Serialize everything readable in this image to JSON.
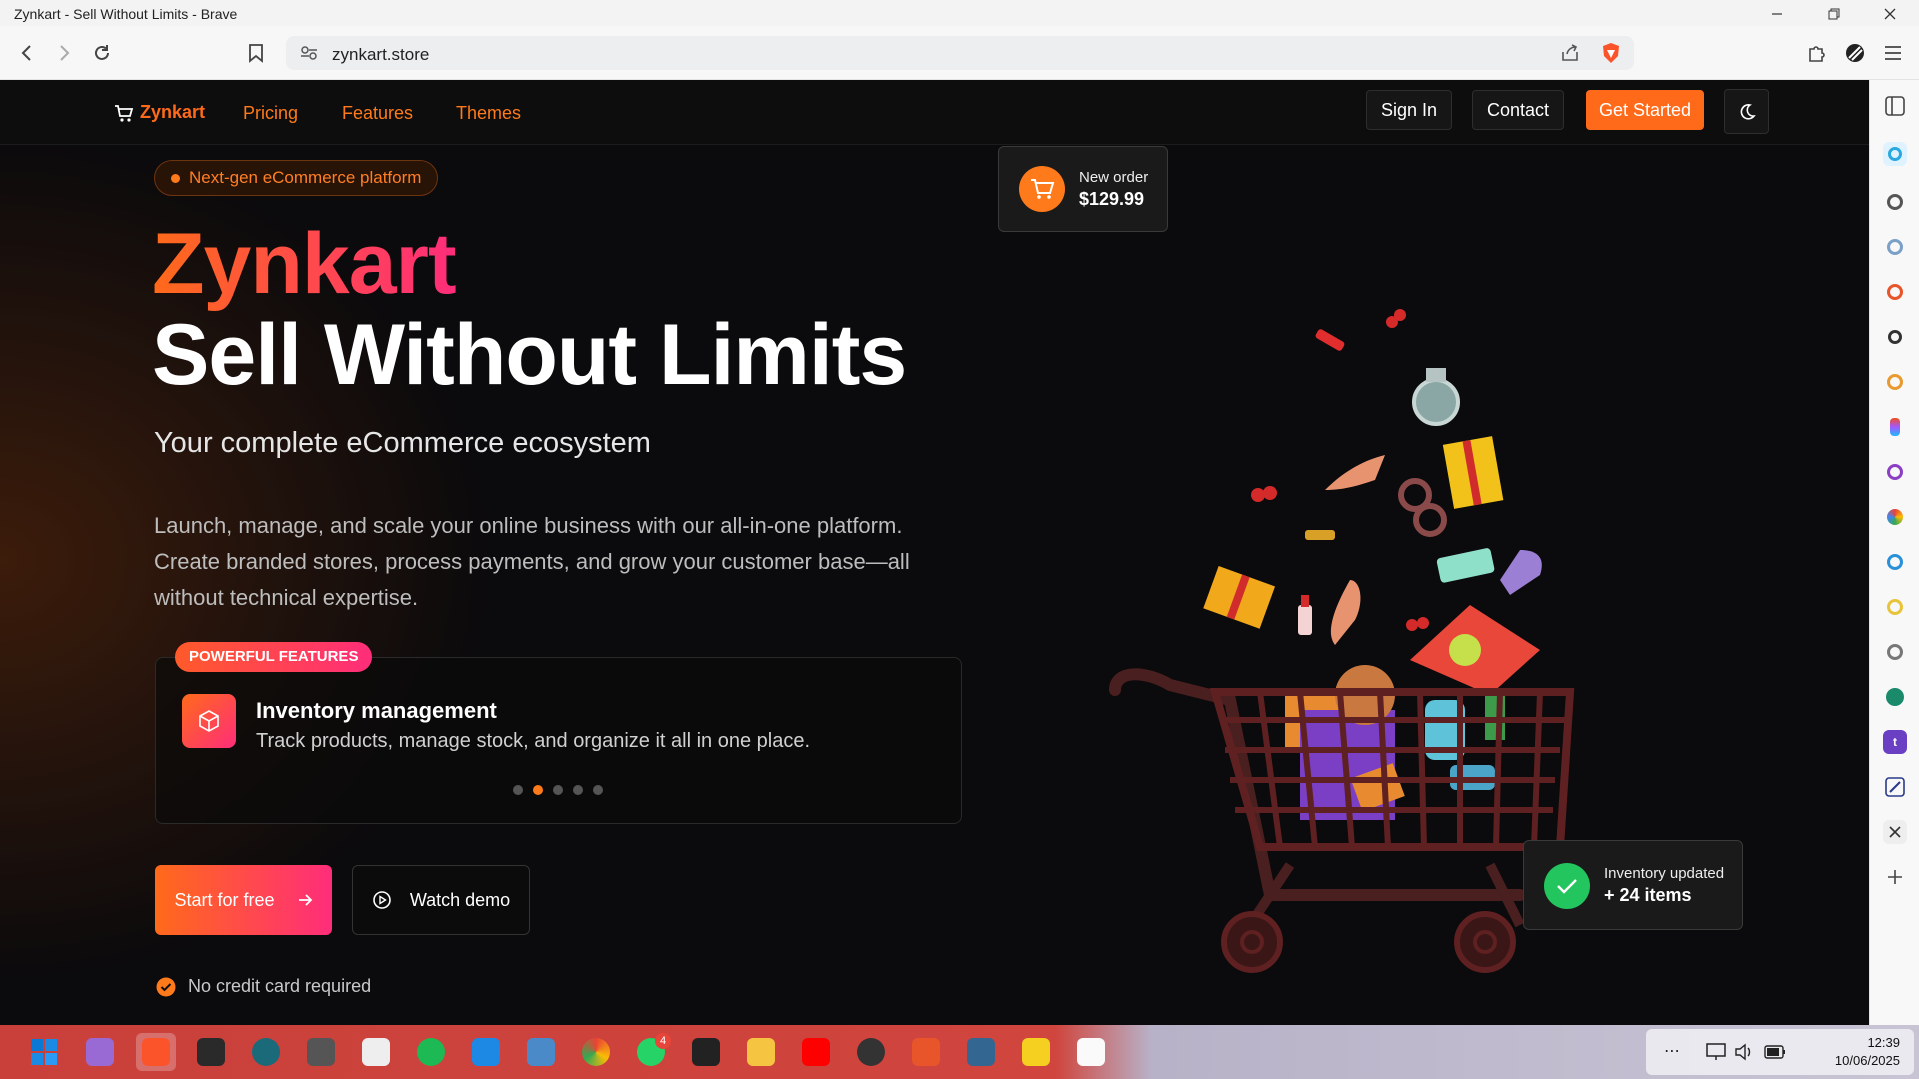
{
  "window": {
    "title": "Zynkart - Sell Without Limits - Brave"
  },
  "browser": {
    "url": "zynkart.store"
  },
  "nav": {
    "brand": "Zynkart",
    "links": [
      "Pricing",
      "Features",
      "Themes"
    ],
    "sign_in": "Sign In",
    "contact": "Contact",
    "get_started": "Get Started"
  },
  "hero": {
    "pill": "Next-gen eCommerce platform",
    "brand_heading": "Zynkart",
    "heading": "Sell Without Limits",
    "subtitle": "Your complete eCommerce ecosystem",
    "description": "Launch, manage, and scale your online business with our all-in-one platform. Create branded stores, process payments, and grow your customer base—all without technical expertise.",
    "features_badge": "POWERFUL FEATURES",
    "feature_title": "Inventory management",
    "feature_text": "Track products, manage stock, and organize it all in one place.",
    "carousel_active": 2,
    "carousel_total": 5,
    "cta_primary": "Start for free",
    "cta_secondary": "Watch demo",
    "note": "No credit card required"
  },
  "cards": {
    "order_label": "New order",
    "order_amount": "$129.99",
    "inventory_label": "Inventory updated",
    "inventory_value": "+ 24 items"
  },
  "taskbar": {
    "whatsapp_badge": "4",
    "time": "12:39",
    "date": "10/06/2025"
  },
  "colors": {
    "accent": "#ff6a1a",
    "accent2": "#ff2d7a",
    "success": "#22c55e"
  }
}
